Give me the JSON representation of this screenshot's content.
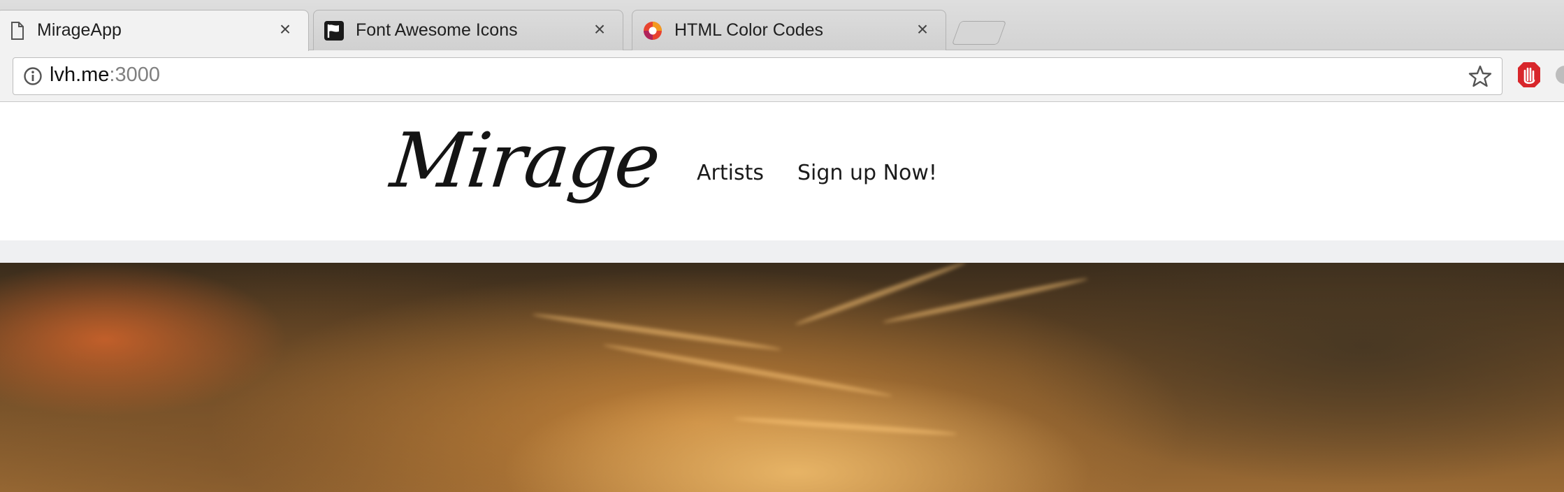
{
  "browser": {
    "tabs": [
      {
        "title": "MirageApp",
        "active": true,
        "favicon": "document-icon"
      },
      {
        "title": "Font Awesome Icons",
        "active": false,
        "favicon": "flag-icon"
      },
      {
        "title": "HTML Color Codes",
        "active": false,
        "favicon": "color-wheel-icon"
      }
    ],
    "close_glyph": "×",
    "address": {
      "host": "lvh.me",
      "port": ":3000"
    }
  },
  "site": {
    "logo_text": "Mirage",
    "nav": [
      {
        "label": "Artists"
      },
      {
        "label": "Sign up Now!"
      }
    ]
  },
  "colors": {
    "header_bg": "#ffffff",
    "band_bg": "#eff0f2",
    "sky_orange": "#c6602a"
  }
}
